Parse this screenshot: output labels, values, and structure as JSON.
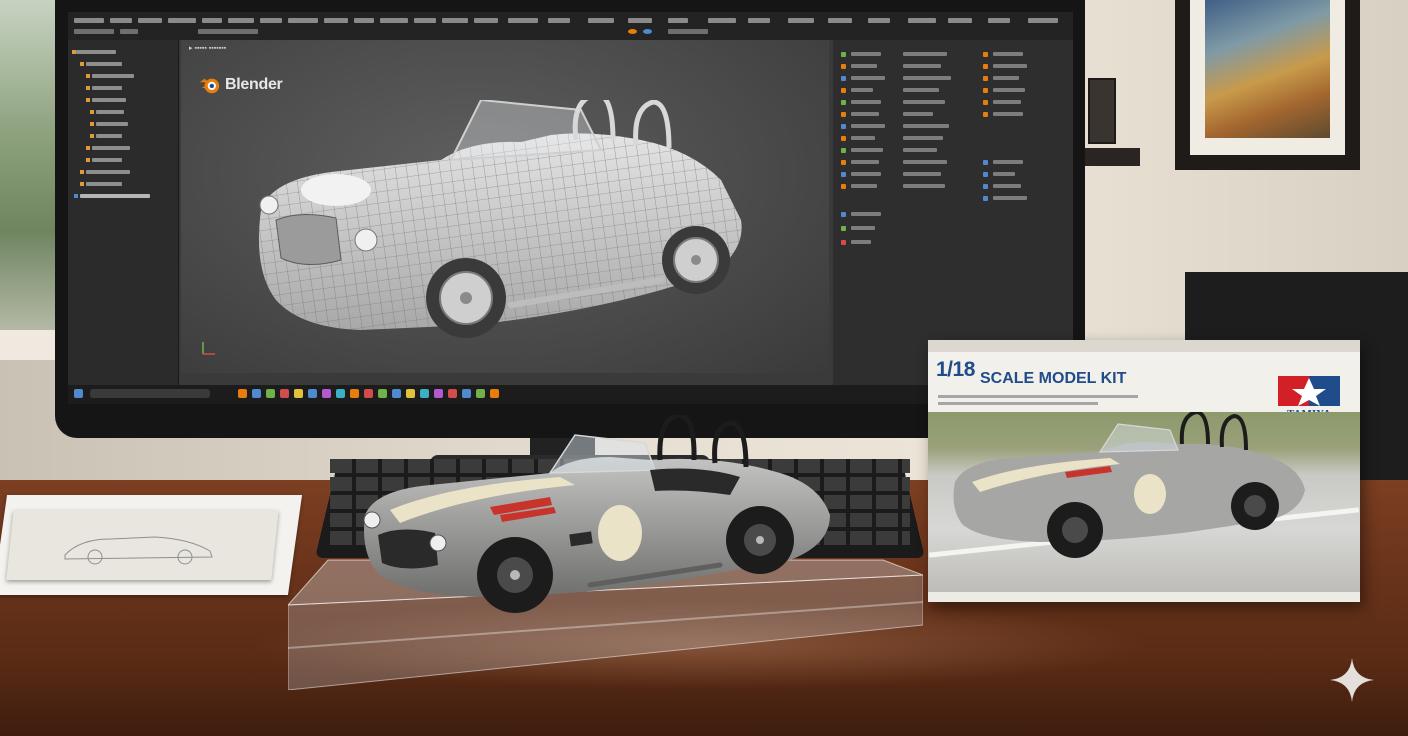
{
  "screen": {
    "app_name": "Blender"
  },
  "box": {
    "scale": "1/18",
    "title": "SCALE MODEL KIT",
    "brand": "TAMIYA"
  },
  "colors": {
    "blender_orange": "#e87d0d",
    "box_blue": "#1f4c8a",
    "tamiya_red": "#d32027",
    "desk_wood": "#6a341b",
    "model_silver": "#9a9a98",
    "stripe_cream": "#eae3c8",
    "accent_red": "#c8342c"
  },
  "icons": {
    "brand": "blender-logo-icon",
    "tamiya": "tamiya-star-icon",
    "sparkle": "sparkle-icon"
  }
}
